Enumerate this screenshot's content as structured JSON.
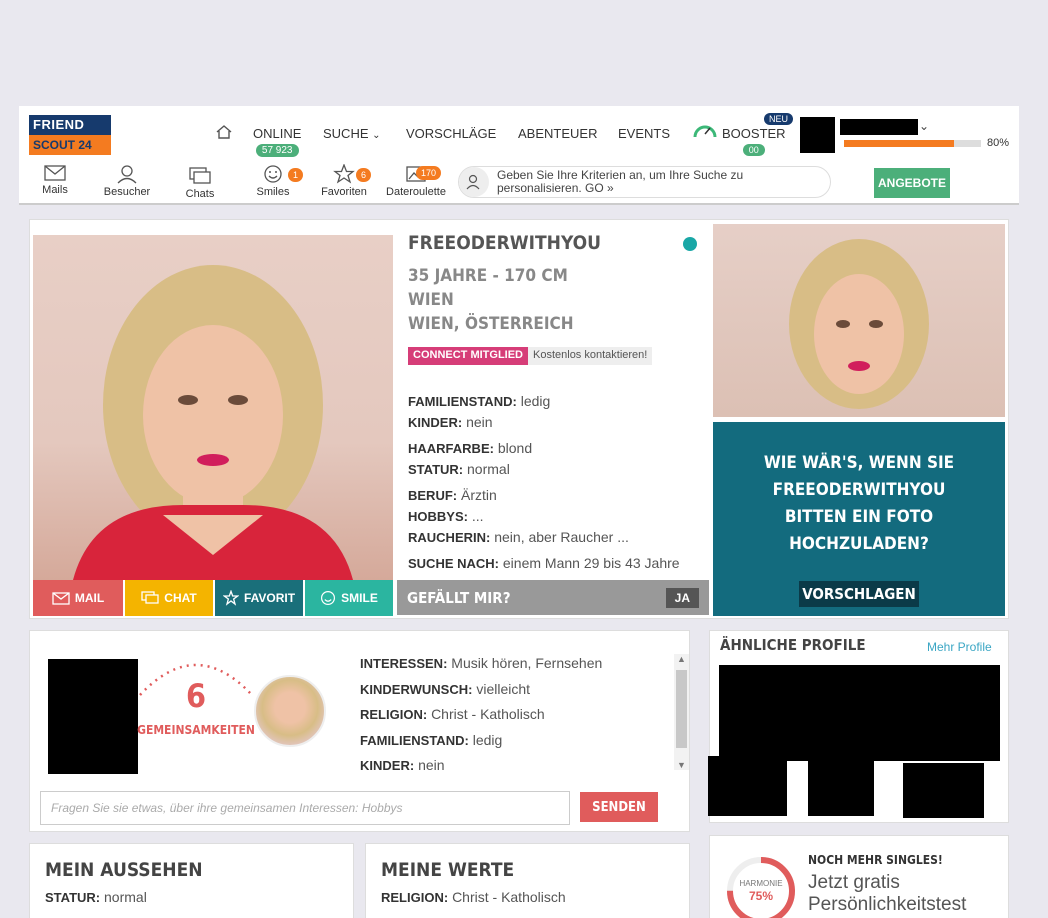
{
  "logo": {
    "line1": "FRIEND",
    "line2": "SCOUT 24"
  },
  "nav": {
    "online_label": "ONLINE",
    "online_count": "57 923",
    "suche": "SUCHE",
    "vorschlaege": "VORSCHLÄGE",
    "abenteuer": "ABENTEUER",
    "events": "EVENTS",
    "booster": "BOOSTER",
    "booster_badge": "NEU",
    "booster_count": "00",
    "progress_pct": 80,
    "progress_label": "80%"
  },
  "subnav": {
    "mails": "Mails",
    "besucher": "Besucher",
    "chats": "Chats",
    "smiles": "Smiles",
    "smiles_count": "1",
    "favoriten": "Favoriten",
    "favoriten_count": "6",
    "dateroulette": "Dateroulette",
    "dateroulette_count": "170",
    "search_hint": "Geben Sie Ihre Kriterien an, um Ihre Suche zu personalisieren. GO »",
    "angebote": "ANGEBOTE"
  },
  "profile": {
    "username": "FREEODERWITHYOU",
    "age_height": "35 JAHRE - 170 CM",
    "city": "WIEN",
    "region": "WIEN, ÖSTERREICH",
    "connect_badge": "CONNECT MITGLIED",
    "connect_text": "Kostenlos kontaktieren!",
    "details": [
      {
        "label": "FAMILIENSTAND:",
        "value": "ledig"
      },
      {
        "label": "KINDER:",
        "value": "nein"
      },
      {
        "label": "HAARFARBE:",
        "value": "blond"
      },
      {
        "label": "STATUR:",
        "value": "normal"
      },
      {
        "label": "BERUF:",
        "value": "Ärztin"
      },
      {
        "label": "HOBBYS:",
        "value": "..."
      },
      {
        "label": "RAUCHERIN:",
        "value": "nein, aber Raucher ..."
      },
      {
        "label": "SUCHE NACH:",
        "value": "einem Mann 29 bis 43 Jahre"
      }
    ],
    "gefaellt_mir": "GEFÄLLT MIR?",
    "ja": "JA",
    "actions": {
      "mail": "MAIL",
      "chat": "CHAT",
      "favorit": "FAVORIT",
      "smile": "SMILE"
    },
    "colors": {
      "mail": "#e05c5c",
      "chat": "#f4b400",
      "favorit": "#1a6f7a",
      "smile": "#2bb5a0",
      "teal": "#136b7e"
    }
  },
  "photo_request": {
    "text_lines": [
      "WIE WÄR'S, WENN SIE",
      "FREEODERWITHYOU",
      "BITTEN EIN FOTO",
      "HOCHZULADEN?"
    ],
    "button": "VORSCHLAGEN"
  },
  "common": {
    "count": "6",
    "label": "GEMEINSAMKEITEN",
    "items": [
      {
        "label": "INTERESSEN:",
        "value": "Musik hören, Fernsehen"
      },
      {
        "label": "KINDERWUNSCH:",
        "value": "vielleicht"
      },
      {
        "label": "RELIGION:",
        "value": "Christ - Katholisch"
      },
      {
        "label": "FAMILIENSTAND:",
        "value": "ledig"
      },
      {
        "label": "KINDER:",
        "value": "nein"
      }
    ],
    "ask_placeholder": "Fragen Sie sie etwas, über ihre gemeinsamen Interessen: Hobbys",
    "send": "SENDEN"
  },
  "similar": {
    "title": "ÄHNLICHE PROFILE",
    "more": "Mehr Profile"
  },
  "aussehen": {
    "title": "MEIN AUSSEHEN",
    "row_label": "STATUR:",
    "row_value": "normal"
  },
  "werte": {
    "title": "MEINE WERTE",
    "row_label": "RELIGION:",
    "row_value": "Christ - Katholisch"
  },
  "singles": {
    "kicker": "NOCH MEHR SINGLES!",
    "line1": "Jetzt gratis",
    "line2": "Persönlichkeitstest",
    "harmonie": "HARMONIE",
    "pct": "75%"
  }
}
